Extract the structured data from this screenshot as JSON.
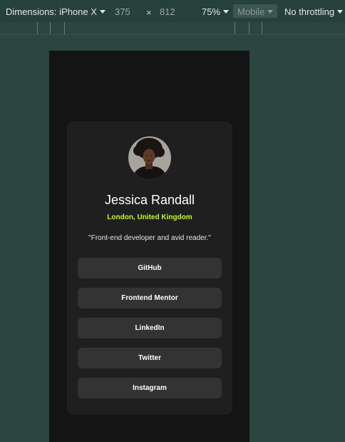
{
  "toolbar": {
    "dimensions_label": "Dimensions: iPhone X",
    "width": "375",
    "times": "×",
    "height": "812",
    "zoom": "75%",
    "mode": "Mobile",
    "throttling": "No throttling"
  },
  "profile": {
    "name": "Jessica Randall",
    "location": "London, United Kingdom",
    "bio": "\"Front-end developer and avid reader.\"",
    "accent_color": "#c4f82a"
  },
  "links": [
    "GitHub",
    "Frontend Mentor",
    "LinkedIn",
    "Twitter",
    "Instagram"
  ]
}
